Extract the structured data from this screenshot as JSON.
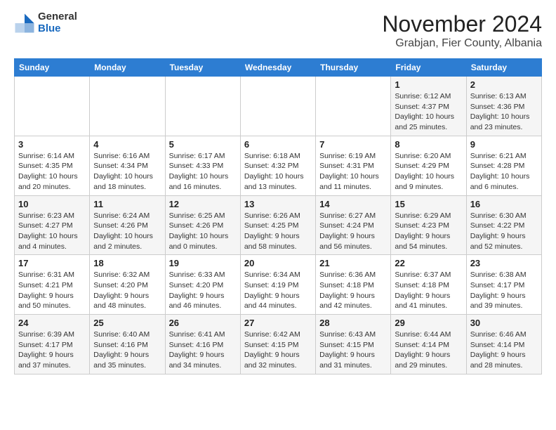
{
  "logo": {
    "general": "General",
    "blue": "Blue"
  },
  "title": "November 2024",
  "subtitle": "Grabjan, Fier County, Albania",
  "days_of_week": [
    "Sunday",
    "Monday",
    "Tuesday",
    "Wednesday",
    "Thursday",
    "Friday",
    "Saturday"
  ],
  "weeks": [
    [
      {
        "day": "",
        "detail": ""
      },
      {
        "day": "",
        "detail": ""
      },
      {
        "day": "",
        "detail": ""
      },
      {
        "day": "",
        "detail": ""
      },
      {
        "day": "",
        "detail": ""
      },
      {
        "day": "1",
        "detail": "Sunrise: 6:12 AM\nSunset: 4:37 PM\nDaylight: 10 hours\nand 25 minutes."
      },
      {
        "day": "2",
        "detail": "Sunrise: 6:13 AM\nSunset: 4:36 PM\nDaylight: 10 hours\nand 23 minutes."
      }
    ],
    [
      {
        "day": "3",
        "detail": "Sunrise: 6:14 AM\nSunset: 4:35 PM\nDaylight: 10 hours\nand 20 minutes."
      },
      {
        "day": "4",
        "detail": "Sunrise: 6:16 AM\nSunset: 4:34 PM\nDaylight: 10 hours\nand 18 minutes."
      },
      {
        "day": "5",
        "detail": "Sunrise: 6:17 AM\nSunset: 4:33 PM\nDaylight: 10 hours\nand 16 minutes."
      },
      {
        "day": "6",
        "detail": "Sunrise: 6:18 AM\nSunset: 4:32 PM\nDaylight: 10 hours\nand 13 minutes."
      },
      {
        "day": "7",
        "detail": "Sunrise: 6:19 AM\nSunset: 4:31 PM\nDaylight: 10 hours\nand 11 minutes."
      },
      {
        "day": "8",
        "detail": "Sunrise: 6:20 AM\nSunset: 4:29 PM\nDaylight: 10 hours\nand 9 minutes."
      },
      {
        "day": "9",
        "detail": "Sunrise: 6:21 AM\nSunset: 4:28 PM\nDaylight: 10 hours\nand 6 minutes."
      }
    ],
    [
      {
        "day": "10",
        "detail": "Sunrise: 6:23 AM\nSunset: 4:27 PM\nDaylight: 10 hours\nand 4 minutes."
      },
      {
        "day": "11",
        "detail": "Sunrise: 6:24 AM\nSunset: 4:26 PM\nDaylight: 10 hours\nand 2 minutes."
      },
      {
        "day": "12",
        "detail": "Sunrise: 6:25 AM\nSunset: 4:26 PM\nDaylight: 10 hours\nand 0 minutes."
      },
      {
        "day": "13",
        "detail": "Sunrise: 6:26 AM\nSunset: 4:25 PM\nDaylight: 9 hours\nand 58 minutes."
      },
      {
        "day": "14",
        "detail": "Sunrise: 6:27 AM\nSunset: 4:24 PM\nDaylight: 9 hours\nand 56 minutes."
      },
      {
        "day": "15",
        "detail": "Sunrise: 6:29 AM\nSunset: 4:23 PM\nDaylight: 9 hours\nand 54 minutes."
      },
      {
        "day": "16",
        "detail": "Sunrise: 6:30 AM\nSunset: 4:22 PM\nDaylight: 9 hours\nand 52 minutes."
      }
    ],
    [
      {
        "day": "17",
        "detail": "Sunrise: 6:31 AM\nSunset: 4:21 PM\nDaylight: 9 hours\nand 50 minutes."
      },
      {
        "day": "18",
        "detail": "Sunrise: 6:32 AM\nSunset: 4:20 PM\nDaylight: 9 hours\nand 48 minutes."
      },
      {
        "day": "19",
        "detail": "Sunrise: 6:33 AM\nSunset: 4:20 PM\nDaylight: 9 hours\nand 46 minutes."
      },
      {
        "day": "20",
        "detail": "Sunrise: 6:34 AM\nSunset: 4:19 PM\nDaylight: 9 hours\nand 44 minutes."
      },
      {
        "day": "21",
        "detail": "Sunrise: 6:36 AM\nSunset: 4:18 PM\nDaylight: 9 hours\nand 42 minutes."
      },
      {
        "day": "22",
        "detail": "Sunrise: 6:37 AM\nSunset: 4:18 PM\nDaylight: 9 hours\nand 41 minutes."
      },
      {
        "day": "23",
        "detail": "Sunrise: 6:38 AM\nSunset: 4:17 PM\nDaylight: 9 hours\nand 39 minutes."
      }
    ],
    [
      {
        "day": "24",
        "detail": "Sunrise: 6:39 AM\nSunset: 4:17 PM\nDaylight: 9 hours\nand 37 minutes."
      },
      {
        "day": "25",
        "detail": "Sunrise: 6:40 AM\nSunset: 4:16 PM\nDaylight: 9 hours\nand 35 minutes."
      },
      {
        "day": "26",
        "detail": "Sunrise: 6:41 AM\nSunset: 4:16 PM\nDaylight: 9 hours\nand 34 minutes."
      },
      {
        "day": "27",
        "detail": "Sunrise: 6:42 AM\nSunset: 4:15 PM\nDaylight: 9 hours\nand 32 minutes."
      },
      {
        "day": "28",
        "detail": "Sunrise: 6:43 AM\nSunset: 4:15 PM\nDaylight: 9 hours\nand 31 minutes."
      },
      {
        "day": "29",
        "detail": "Sunrise: 6:44 AM\nSunset: 4:14 PM\nDaylight: 9 hours\nand 29 minutes."
      },
      {
        "day": "30",
        "detail": "Sunrise: 6:46 AM\nSunset: 4:14 PM\nDaylight: 9 hours\nand 28 minutes."
      }
    ]
  ]
}
